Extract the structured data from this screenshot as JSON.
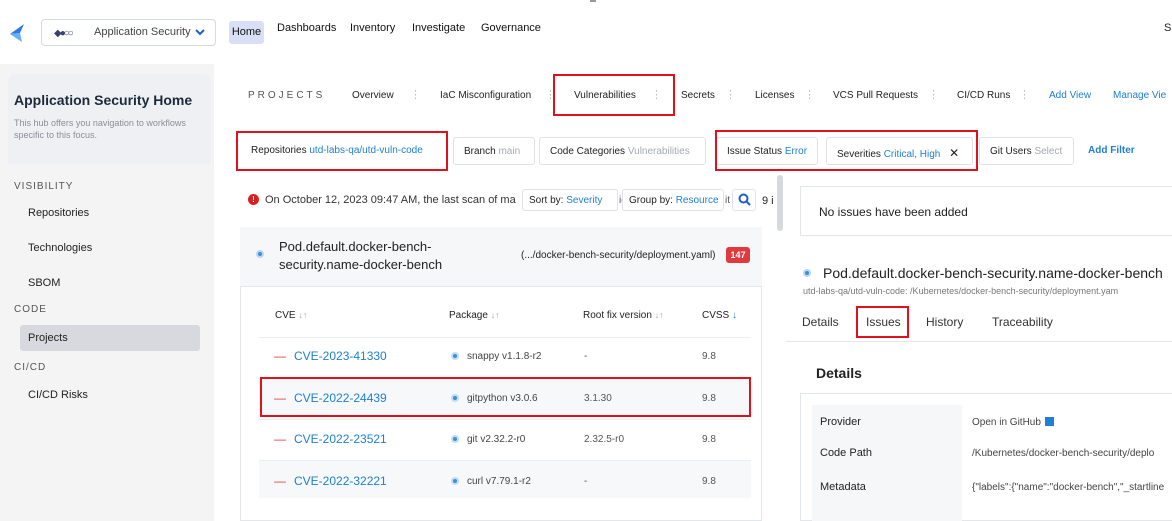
{
  "app": {
    "selector_label": "Application Security"
  },
  "nav": {
    "home": "Home",
    "dashboards": "Dashboards",
    "inventory": "Inventory",
    "investigate": "Investigate",
    "governance": "Governance",
    "edge": "S"
  },
  "sidebar": {
    "title": "Application Security Home",
    "subtitle": "This hub offers you navigation to workflows specific to this focus.",
    "sections": {
      "visibility": "VISIBILITY",
      "code": "CODE",
      "cicd": "CI/CD"
    },
    "items": {
      "repositories": "Repositories",
      "technologies": "Technologies",
      "sbom": "SBOM",
      "projects": "Projects",
      "cicd_risks": "CI/CD Risks"
    }
  },
  "projects": {
    "label": "PROJECTS",
    "tabs": {
      "overview": "Overview",
      "iac": "IaC Misconfiguration",
      "vulns": "Vulnerabilities",
      "secrets": "Secrets",
      "licenses": "Licenses",
      "vcs": "VCS Pull Requests",
      "cicd_runs": "CI/CD Runs"
    },
    "add_view": "Add View",
    "manage_view": "Manage Vie"
  },
  "filters": {
    "repositories": {
      "label": "Repositories",
      "value": "utd-labs-qa/utd-vuln-code"
    },
    "branch": {
      "label": "Branch",
      "value": "main"
    },
    "code_categories": {
      "label": "Code Categories",
      "value": "Vulnerabilities"
    },
    "issue_status": {
      "label": "Issue Status",
      "value": "Error"
    },
    "severities": {
      "label": "Severities",
      "value": "Critical, High"
    },
    "git_users": {
      "label": "Git Users",
      "value": "Select"
    },
    "add_filter": "Add Filter"
  },
  "scan": {
    "message": "On October 12, 2023 09:47 AM, the last scan of ma",
    "sort_label": "Sort by:",
    "sort_value": "Severity",
    "sort_tail": "ie",
    "group_label": "Group by:",
    "group_value": "Resource",
    "group_tail": "it",
    "count_tail": "9 i"
  },
  "resource": {
    "title": "Pod.default.docker-bench-security.name-docker-bench",
    "path": "(.../docker-bench-security/deployment.yaml)",
    "count": "147"
  },
  "table": {
    "headers": {
      "cve": "CVE",
      "package": "Package",
      "fix": "Root fix version",
      "cvss": "CVSS"
    },
    "rows": [
      {
        "cve": "CVE-2023-41330",
        "package": "snappy v1.1.8-r2",
        "fix": "-",
        "cvss": "9.8"
      },
      {
        "cve": "CVE-2022-24439",
        "package": "gitpython v3.0.6",
        "fix": "3.1.30",
        "cvss": "9.8"
      },
      {
        "cve": "CVE-2022-23521",
        "package": "git v2.32.2-r0",
        "fix": "2.32.5-r0",
        "cvss": "9.8"
      },
      {
        "cve": "CVE-2022-32221",
        "package": "curl v7.79.1-r2",
        "fix": "-",
        "cvss": "9.8"
      }
    ]
  },
  "panel": {
    "no_issues": "No issues have been added",
    "title": "Pod.default.docker-bench-security.name-docker-bench",
    "subtitle": "utd-labs-qa/utd-vuln-code: /Kubernetes/docker-bench-security/deployment.yam",
    "tabs": {
      "details": "Details",
      "issues": "Issues",
      "history": "History",
      "traceability": "Traceability"
    },
    "details_heading": "Details",
    "rows": {
      "provider": {
        "label": "Provider",
        "value": "Open in GitHub"
      },
      "code_path": {
        "label": "Code Path",
        "value": "/Kubernetes/docker-bench-security/deplo"
      },
      "metadata": {
        "label": "Metadata",
        "value": "{\"labels\":{\"name\":\"docker-bench\",\"_startline"
      }
    }
  },
  "colors": {
    "accent": "#1e7fd4",
    "highlight": "#e0101c",
    "badge": "#e03a3e"
  }
}
